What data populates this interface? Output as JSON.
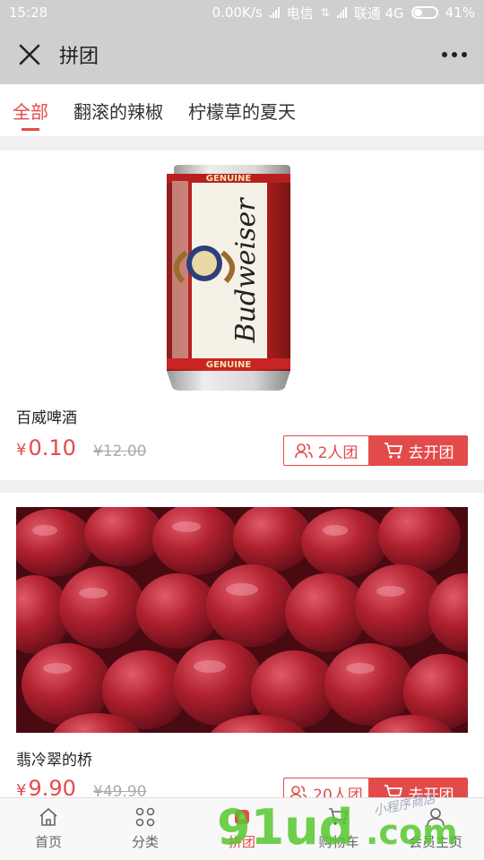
{
  "status_bar": {
    "time": "15:28",
    "speed": "0.00K/s",
    "carrier1": "电信",
    "carrier2": "联通 4G",
    "battery": "41%",
    "battery_level": 0.41
  },
  "navbar": {
    "title": "拼团"
  },
  "tabs": [
    {
      "label": "全部",
      "active": true
    },
    {
      "label": "翻滚的辣椒",
      "active": false
    },
    {
      "label": "柠檬草的夏天",
      "active": false
    }
  ],
  "products": [
    {
      "name": "百威啤酒",
      "currency": "¥",
      "price": "0.10",
      "original_price": "¥12.00",
      "group_size": "2人团",
      "action": "去开团",
      "image": "beer-can"
    },
    {
      "name": "翡冷翠的桥",
      "currency": "¥",
      "price": "9.90",
      "original_price": "¥49.90",
      "group_size": "20人团",
      "action": "去开团",
      "image": "dried-cranberries"
    }
  ],
  "bottom_bar": [
    {
      "label": "首页",
      "icon": "home-icon"
    },
    {
      "label": "分类",
      "icon": "grid-icon"
    },
    {
      "label": "拼团",
      "icon": "group-buy-icon"
    },
    {
      "label": "购物车",
      "icon": "cart-icon"
    },
    {
      "label": "会员主页",
      "icon": "user-icon"
    }
  ],
  "watermark": {
    "brand": "91ud",
    "suffix": ".com",
    "tagline": "小程序商店"
  },
  "colors": {
    "accent": "#e34b4b",
    "statusbar": "#cfcfcf"
  }
}
